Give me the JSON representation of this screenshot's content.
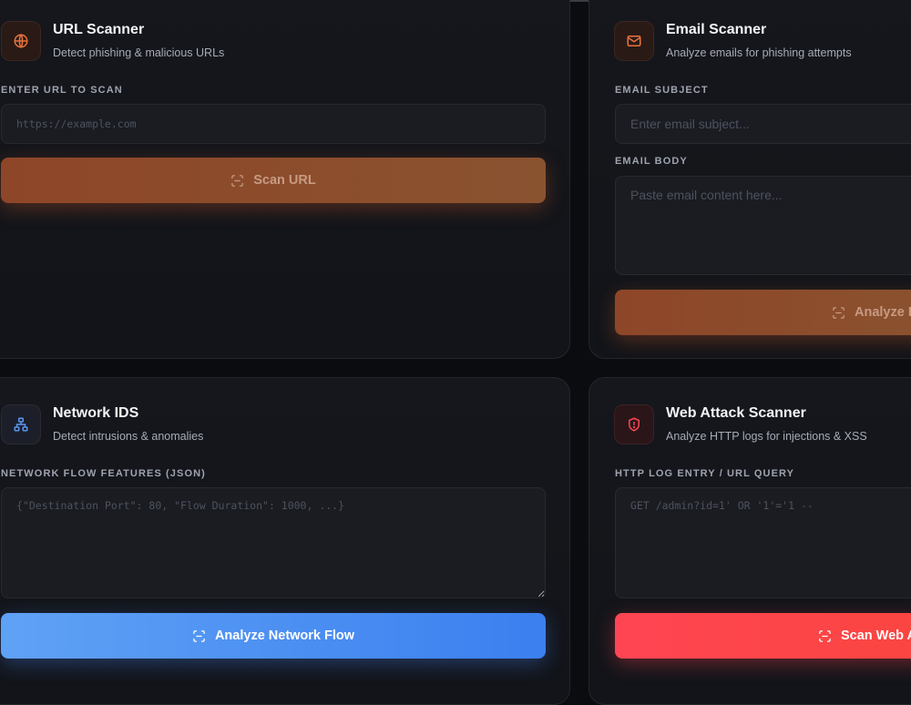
{
  "url_scanner": {
    "title": "URL Scanner",
    "subtitle": "Detect phishing & malicious URLs",
    "icon": "globe-icon",
    "field_label": "ENTER URL TO SCAN",
    "placeholder": "https://example.com",
    "value": "",
    "button_label": "Scan URL",
    "button_icon": "scan-icon"
  },
  "email_scanner": {
    "title": "Email Scanner",
    "subtitle": "Analyze emails for phishing attempts",
    "icon": "mail-icon",
    "subject_label": "EMAIL SUBJECT",
    "subject_placeholder": "Enter email subject...",
    "body_label": "EMAIL BODY",
    "body_placeholder": "Paste email content here...",
    "button_label": "Analyze E",
    "button_icon": "scan-icon"
  },
  "network_ids": {
    "title": "Network IDS",
    "subtitle": "Detect intrusions & anomalies",
    "icon": "network-icon",
    "field_label": "NETWORK FLOW FEATURES (JSON)",
    "placeholder": "{\"Destination Port\": 80, \"Flow Duration\": 1000, ...}",
    "button_label": "Analyze Network Flow",
    "button_icon": "scan-icon"
  },
  "web_attack_scanner": {
    "title": "Web Attack Scanner",
    "subtitle": "Analyze HTTP logs for injections & XSS",
    "icon": "shield-alert-icon",
    "field_label": "HTTP LOG ENTRY / URL QUERY",
    "placeholder": "GET /admin?id=1' OR '1'='1 --",
    "button_label": "Scan Web A",
    "button_icon": "scan-icon"
  },
  "colors": {
    "background": "#0b0c0f",
    "card": "#14161b",
    "accent_orange": "#e8733e",
    "accent_blue": "#4f8ef2",
    "accent_red": "#ff4553"
  }
}
